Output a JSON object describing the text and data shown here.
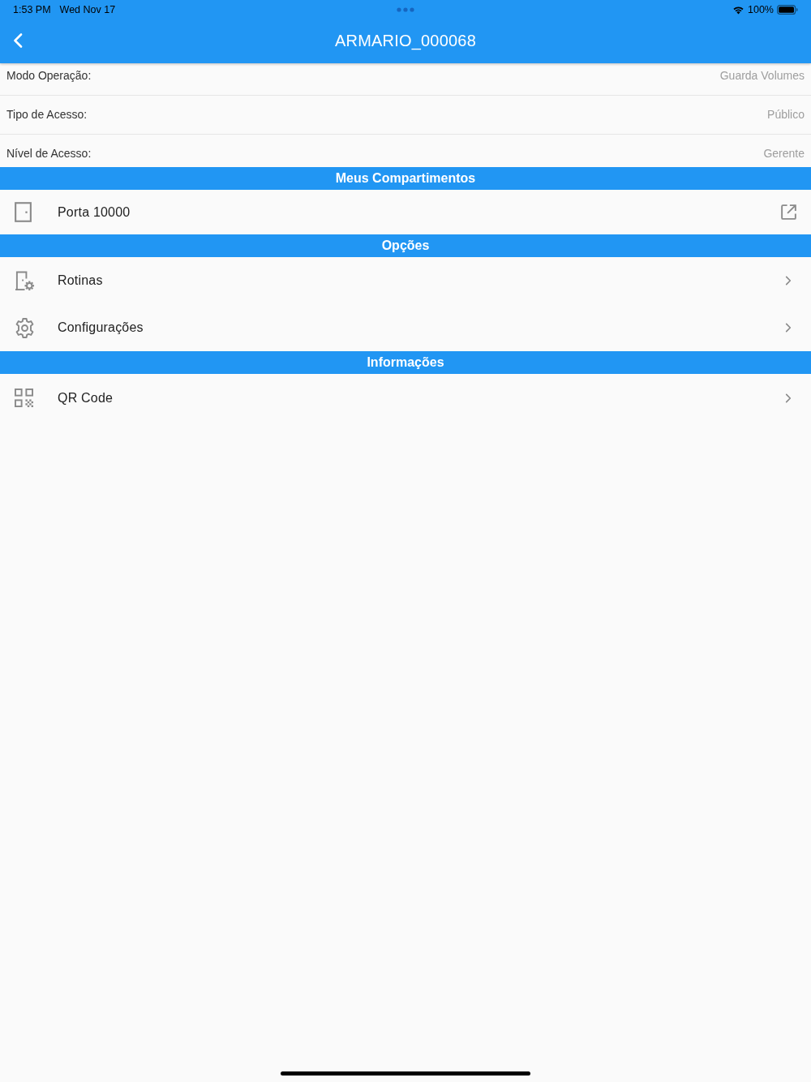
{
  "status_bar": {
    "time": "1:53 PM",
    "date": "Wed Nov 17",
    "battery": "100%"
  },
  "app_bar": {
    "title": "ARMARIO_000068"
  },
  "info_rows": [
    {
      "label": "Modo Operação:",
      "value": "Guarda Volumes"
    },
    {
      "label": "Tipo de Acesso:",
      "value": "Público"
    },
    {
      "label": "Nível de Acesso:",
      "value": "Gerente"
    }
  ],
  "sections": [
    {
      "title": "Meus Compartimentos",
      "items": [
        {
          "label": "Porta 10000",
          "kind": "compartment"
        }
      ]
    },
    {
      "title": "Opções",
      "items": [
        {
          "label": "Rotinas",
          "kind": "routines"
        },
        {
          "label": "Configurações",
          "kind": "settings"
        }
      ]
    },
    {
      "title": "Informações",
      "items": [
        {
          "label": "QR Code",
          "kind": "qrcode"
        }
      ]
    }
  ]
}
